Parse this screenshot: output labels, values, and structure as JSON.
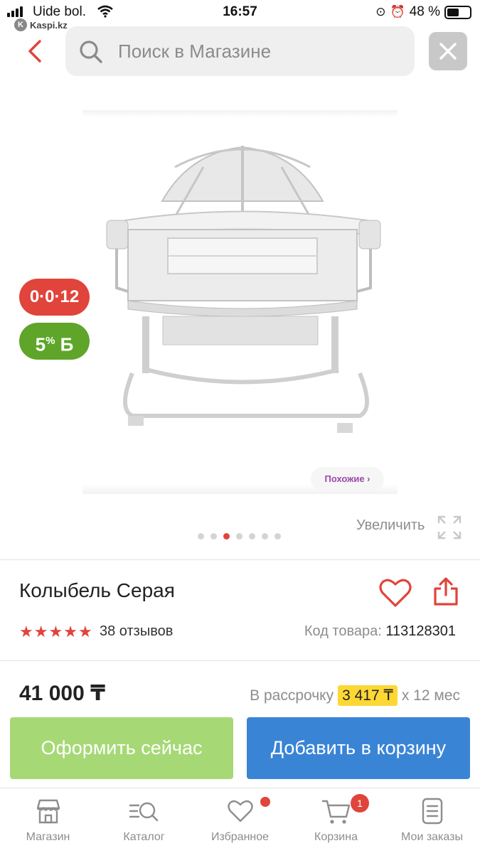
{
  "status_bar": {
    "carrier": "Uide bol.",
    "time": "16:57",
    "battery": "48 %",
    "back_app": "Kaspi.kz"
  },
  "header": {
    "search_placeholder": "Поиск в Магазине"
  },
  "product": {
    "badges": {
      "installment": "0·0·12",
      "bonus_percent": "5",
      "bonus_unit": "Б"
    },
    "similar_label": "Похожие ›",
    "zoom_label": "Увеличить",
    "gallery": {
      "count": 7,
      "active": 3
    },
    "title": "Колыбель Серая",
    "rating": 5,
    "reviews": "38 отзывов",
    "code_label": "Код товара:",
    "code_value": "113128301",
    "price": "41 000 ₸",
    "installment_label": "В рассрочку",
    "installment_amount": "3 417 ₸",
    "installment_term": "х 12 мес",
    "buy_now_label": "Оформить сейчас",
    "add_to_cart_label": "Добавить в корзину"
  },
  "colors": {
    "accent_red": "#e0443b",
    "green_button": "#a6d976",
    "blue_button": "#3a84d6",
    "bonus_green": "#5ea52a",
    "installment_highlight": "#fdd835"
  },
  "tabbar": {
    "items": [
      {
        "label": "Магазин",
        "icon": "store-icon"
      },
      {
        "label": "Каталог",
        "icon": "catalog-search-icon"
      },
      {
        "label": "Избранное",
        "icon": "heart-icon"
      },
      {
        "label": "Корзина",
        "icon": "cart-icon",
        "badge": "1"
      },
      {
        "label": "Мои заказы",
        "icon": "orders-icon"
      }
    ]
  }
}
